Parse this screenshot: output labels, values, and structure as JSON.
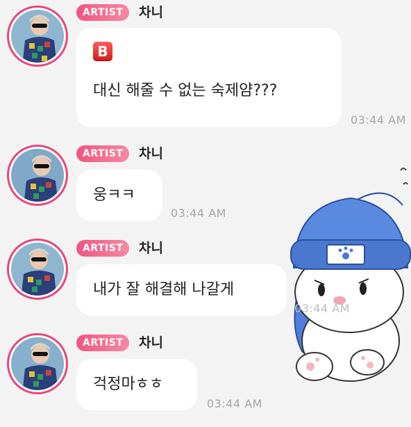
{
  "messages": [
    {
      "badge": "ARTIST",
      "name": "차니",
      "emoji": "B",
      "text": "대신 해줄 수 없는 숙제얌???",
      "time": "03:44 AM"
    },
    {
      "badge": "ARTIST",
      "name": "차니",
      "text": "웅ㅋㅋ",
      "time": "03:44 AM"
    },
    {
      "badge": "ARTIST",
      "name": "차니",
      "text": "내가 잘 해결해 나갈게",
      "time": "03:44 AM"
    },
    {
      "badge": "ARTIST",
      "name": "차니",
      "text": "걱정마ㅎㅎ",
      "time": "03:44 AM"
    }
  ],
  "colors": {
    "background": "#f3f3f4",
    "artist_badge": "#f0557f",
    "avatar_ring": "#e8457c",
    "bubble": "#ffffff",
    "timestamp": "#a6a6ab"
  },
  "icons": {
    "b_emoji": "b-button-icon",
    "sticker": "bunny-in-blue-beanie-sticker"
  }
}
